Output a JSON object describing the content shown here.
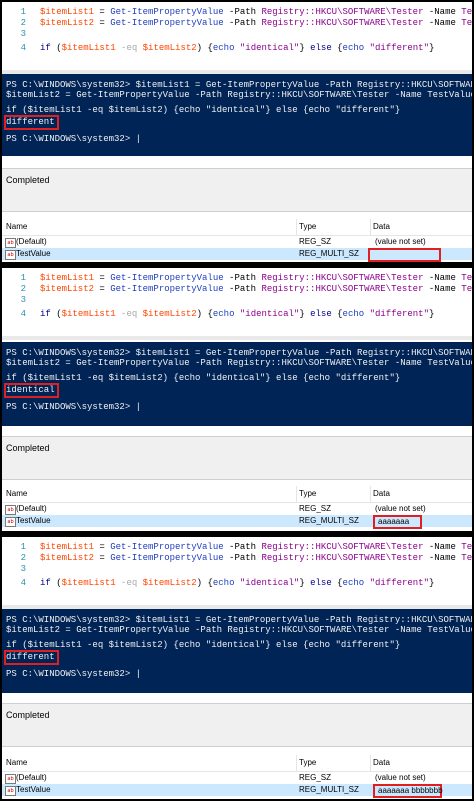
{
  "panels": [
    {
      "editor": {
        "lines": [
          {
            "num": "1",
            "var": "$itemList1",
            "eq": " = ",
            "cmd": "Get-ItemPropertyValue",
            "p1": " -Path ",
            "v1": "Registry::HKCU\\SOFTWARE\\Tester",
            "p2": " -Name ",
            "v2": "TestValue"
          },
          {
            "num": "2",
            "var": "$itemList2",
            "eq": " = ",
            "cmd": "Get-ItemPropertyValue",
            "p1": " -Path ",
            "v1": "Registry::HKCU\\SOFTWARE\\Tester",
            "p2": " -Name ",
            "v2": "TestValue"
          },
          {
            "num": "3"
          },
          {
            "num": "4"
          }
        ],
        "if_line": {
          "kw_if": "if",
          "a": "$itemList1",
          "op": "-eq",
          "b": "$itemList2",
          "echo1": "echo",
          "s1": "\"identical\"",
          "kw_else": "else",
          "echo2": "echo",
          "s2": "\"different\""
        }
      },
      "console": {
        "lines": [
          "PS C:\\WINDOWS\\system32> $itemList1 = Get-ItemPropertyValue -Path Registry::HKCU\\SOFTWARE\\Tester",
          "$itemList2 = Get-ItemPropertyValue -Path Registry::HKCU\\SOFTWARE\\Tester -Name TestValue",
          "if ($itemList1 -eq $itemList2) {echo \"identical\"} else {echo \"different\"}"
        ],
        "result": "different",
        "prompt": "PS C:\\WINDOWS\\system32> |"
      },
      "status": "Completed",
      "registry": {
        "headers": [
          "Name",
          "Type",
          "Data"
        ],
        "rows": [
          {
            "icon": "ab",
            "name": "(Default)",
            "type": "REG_SZ",
            "data": "(value not set)"
          },
          {
            "icon": "ab",
            "name": "TestValue",
            "type": "REG_MULTI_SZ",
            "data": ""
          }
        ]
      }
    },
    {
      "editor": {
        "lines": [
          {
            "num": "1",
            "var": "$itemList1",
            "eq": " = ",
            "cmd": "Get-ItemPropertyValue",
            "p1": " -Path ",
            "v1": "Registry::HKCU\\SOFTWARE\\Tester",
            "p2": " -Name ",
            "v2": "TestValue"
          },
          {
            "num": "2",
            "var": "$itemList2",
            "eq": " = ",
            "cmd": "Get-ItemPropertyValue",
            "p1": " -Path ",
            "v1": "Registry::HKCU\\SOFTWARE\\Tester",
            "p2": " -Name ",
            "v2": "TestValue"
          },
          {
            "num": "3"
          },
          {
            "num": "4"
          }
        ],
        "if_line": {
          "kw_if": "if",
          "a": "$itemList1",
          "op": "-eq",
          "b": "$itemList2",
          "echo1": "echo",
          "s1": "\"identical\"",
          "kw_else": "else",
          "echo2": "echo",
          "s2": "\"different\""
        }
      },
      "console": {
        "lines": [
          "PS C:\\WINDOWS\\system32> $itemList1 = Get-ItemPropertyValue -Path Registry::HKCU\\SOFTWARE\\Tester",
          "$itemList2 = Get-ItemPropertyValue -Path Registry::HKCU\\SOFTWARE\\Tester -Name TestValue",
          "if ($itemList1 -eq $itemList2) {echo \"identical\"} else {echo \"different\"}"
        ],
        "result": "identical",
        "prompt": "PS C:\\WINDOWS\\system32> |"
      },
      "status": "Completed",
      "registry": {
        "headers": [
          "Name",
          "Type",
          "Data"
        ],
        "rows": [
          {
            "icon": "ab",
            "name": "(Default)",
            "type": "REG_SZ",
            "data": "(value not set)"
          },
          {
            "icon": "ab",
            "name": "TestValue",
            "type": "REG_MULTI_SZ",
            "data": "aaaaaaa"
          }
        ]
      }
    },
    {
      "editor": {
        "lines": [
          {
            "num": "1",
            "var": "$itemList1",
            "eq": " = ",
            "cmd": "Get-ItemPropertyValue",
            "p1": " -Path ",
            "v1": "Registry::HKCU\\SOFTWARE\\Tester",
            "p2": " -Name ",
            "v2": "TestValue"
          },
          {
            "num": "2",
            "var": "$itemList2",
            "eq": " = ",
            "cmd": "Get-ItemPropertyValue",
            "p1": " -Path ",
            "v1": "Registry::HKCU\\SOFTWARE\\Tester",
            "p2": " -Name ",
            "v2": "TestValue"
          },
          {
            "num": "3"
          },
          {
            "num": "4"
          }
        ],
        "if_line": {
          "kw_if": "if",
          "a": "$itemList1",
          "op": "-eq",
          "b": "$itemList2",
          "echo1": "echo",
          "s1": "\"identical\"",
          "kw_else": "else",
          "echo2": "echo",
          "s2": "\"different\""
        }
      },
      "console": {
        "lines": [
          "PS C:\\WINDOWS\\system32> $itemList1 = Get-ItemPropertyValue -Path Registry::HKCU\\SOFTWARE\\Tester",
          "$itemList2 = Get-ItemPropertyValue -Path Registry::HKCU\\SOFTWARE\\Tester -Name TestValue",
          "if ($itemList1 -eq $itemList2) {echo \"identical\"} else {echo \"different\"}"
        ],
        "result": "different",
        "prompt": "PS C:\\WINDOWS\\system32> |"
      },
      "status": "Completed",
      "registry": {
        "headers": [
          "Name",
          "Type",
          "Data"
        ],
        "rows": [
          {
            "icon": "ab",
            "name": "(Default)",
            "type": "REG_SZ",
            "data": "(value not set)"
          },
          {
            "icon": "ab",
            "name": "TestValue",
            "type": "REG_MULTI_SZ",
            "data": "aaaaaaa bbbbbbb"
          }
        ]
      }
    }
  ],
  "colors": {
    "console_bg": "#012456",
    "highlight": "#e02020",
    "selected_row": "#cce8ff"
  }
}
